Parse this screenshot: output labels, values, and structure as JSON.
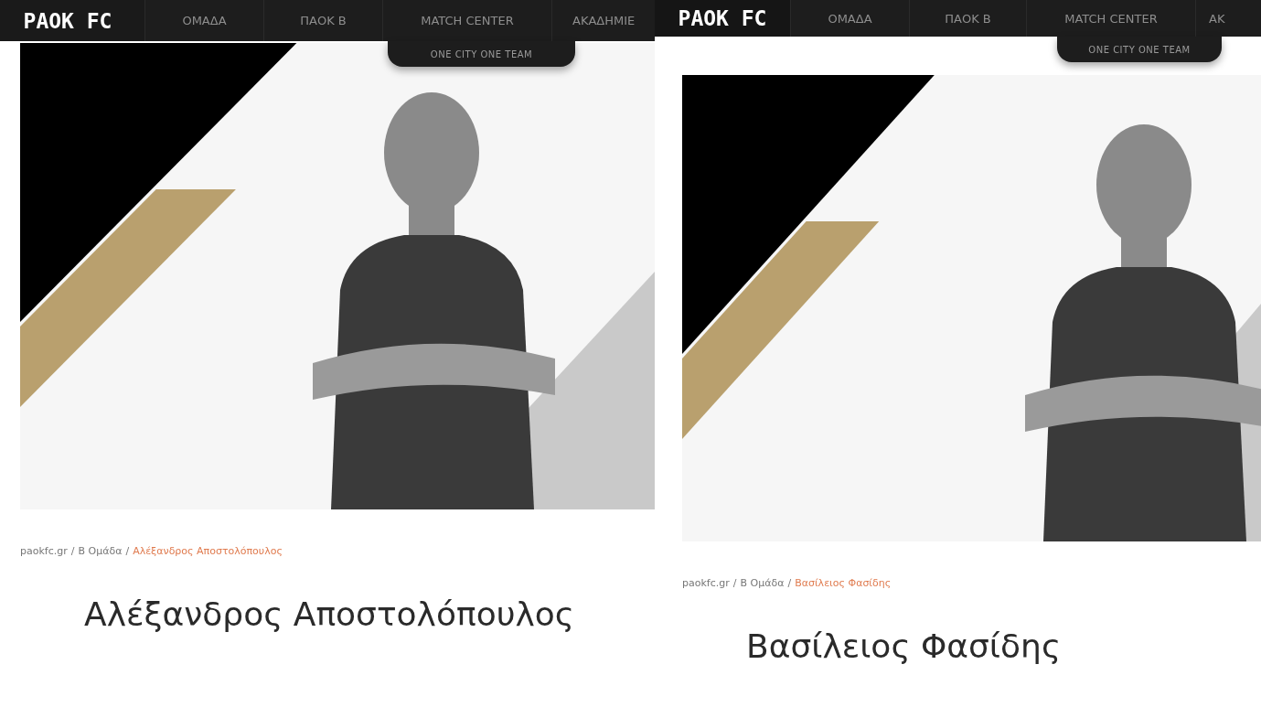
{
  "panels": [
    {
      "nav": {
        "logo": "PAOK FC",
        "items": [
          "ΟΜΑΔΑ",
          "ΠΑΟΚ Β",
          "MATCH CENTER",
          "ΑΚΑΔΗΜΙΕ"
        ],
        "tagline": "ONE CITY ONE TEAM"
      },
      "breadcrumb": {
        "separator": "/",
        "items": [
          {
            "text": "paokfc.gr",
            "current": false
          },
          {
            "text": "Β Ομάδα",
            "current": false
          },
          {
            "text": "Αλέξανδρος Αποστολόπουλος",
            "current": true
          }
        ]
      },
      "name": "Αλέξανδρος Αποστολόπουλος"
    },
    {
      "nav": {
        "logo": "PAOK FC",
        "items": [
          "ΟΜΑΔΑ",
          "ΠΑΟΚ Β",
          "MATCH CENTER",
          "ΑΚ"
        ],
        "tagline": "ONE CITY ONE TEAM"
      },
      "breadcrumb": {
        "separator": "/",
        "items": [
          {
            "text": "paokfc.gr",
            "current": false
          },
          {
            "text": "Β Ομάδα",
            "current": false
          },
          {
            "text": "Βασίλειος Φασίδης",
            "current": true
          }
        ]
      },
      "name": "Βασίλειος Φασίδης"
    }
  ]
}
